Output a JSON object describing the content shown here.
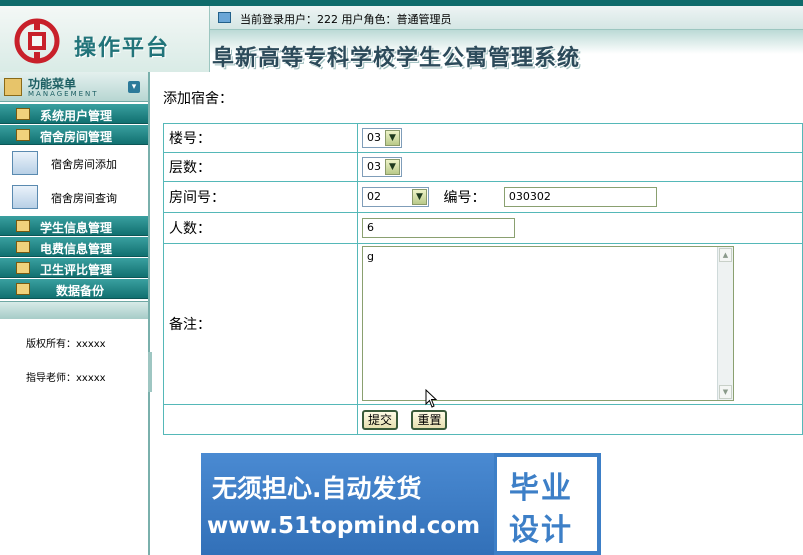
{
  "header": {
    "platform_title": "操作平台",
    "system_title": "阜新高等专科学校学生公寓管理系统",
    "user_info": "当前登录用户：222    用户角色：普通管理员",
    "logo_color": "#c8202a"
  },
  "sidebar": {
    "menu_title": "功能菜单",
    "menu_subtitle": "MANAGEMENT",
    "categories": [
      {
        "label": "系统用户管理"
      },
      {
        "label": "宿舍房间管理"
      },
      {
        "label": "学生信息管理"
      },
      {
        "label": "电费信息管理"
      },
      {
        "label": "卫生评比管理"
      },
      {
        "label": "数据备份"
      }
    ],
    "sub_items": [
      {
        "label": "宿舍房间添加"
      },
      {
        "label": "宿舍房间查询"
      }
    ],
    "copyright": "版权所有：xxxxx",
    "advisor": "指导老师：xxxxx"
  },
  "main": {
    "page_title": "添加宿舍：",
    "form": {
      "building_label": "楼号：",
      "building_value": "03",
      "floor_label": "层数：",
      "floor_value": "03",
      "room_label": "房间号：",
      "room_value": "02",
      "code_label": "编号：",
      "code_value": "030302",
      "capacity_label": "人数：",
      "capacity_value": "6",
      "remark_label": "备注：",
      "remark_value": "g",
      "submit_label": "提交",
      "reset_label": "重置"
    }
  },
  "banner": {
    "slogan": "无须担心.自动发货",
    "url": "www.51topmind.com",
    "badge_line1": "毕业",
    "badge_line2": "设计"
  },
  "colors": {
    "accent_teal": "#117070",
    "table_border": "#55b8b8",
    "banner_blue": "#3d7fc7"
  }
}
